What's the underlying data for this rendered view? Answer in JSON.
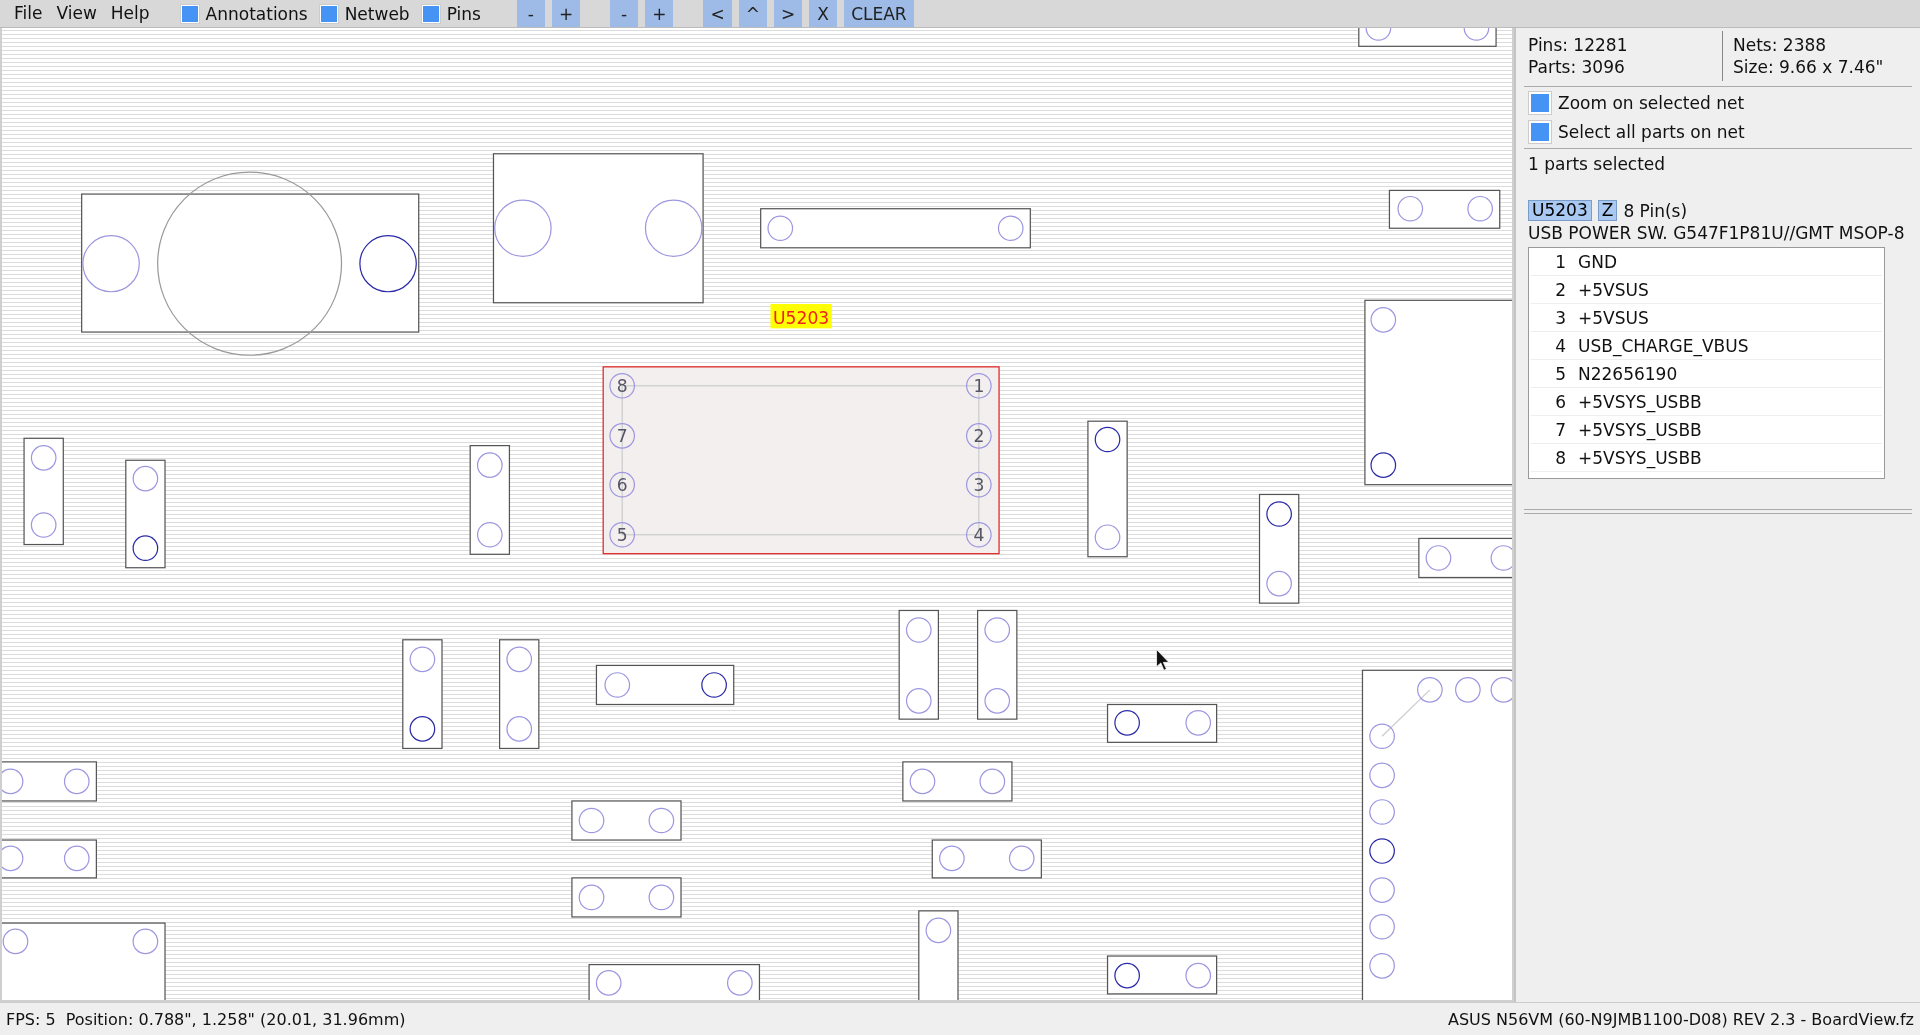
{
  "menu": [
    "File",
    "View",
    "Help"
  ],
  "toolbar": {
    "toggles": [
      {
        "label": "Annotations",
        "checked": true
      },
      {
        "label": "Netweb",
        "checked": true
      },
      {
        "label": "Pins",
        "checked": true
      }
    ],
    "button_groups": [
      [
        "-",
        "+"
      ],
      [
        "-",
        "+"
      ],
      [
        "<",
        "^",
        ">",
        "X",
        "CLEAR"
      ]
    ]
  },
  "canvas": {
    "selected_part": {
      "label": "U5203",
      "pins": [
        "8",
        "7",
        "6",
        "5",
        "1",
        "2",
        "3",
        "4"
      ]
    }
  },
  "panel": {
    "stats_left": [
      "Pins: 12281",
      "Parts: 3096"
    ],
    "stats_right": [
      "Nets: 2388",
      "Size: 9.66 x 7.46\""
    ],
    "options": [
      {
        "label": "Zoom on selected net",
        "checked": true
      },
      {
        "label": "Select all parts on net",
        "checked": true
      }
    ],
    "selection_count": "1 parts selected",
    "part": {
      "name": "U5203",
      "zoom_button": "Z",
      "pin_count": "8 Pin(s)",
      "description": "USB POWER SW. G547F1P81U//GMT MSOP-8",
      "pins": [
        {
          "number": "1",
          "net": "GND"
        },
        {
          "number": "2",
          "net": "+5VSUS"
        },
        {
          "number": "3",
          "net": "+5VSUS"
        },
        {
          "number": "4",
          "net": "USB_CHARGE_VBUS"
        },
        {
          "number": "5",
          "net": "N22656190"
        },
        {
          "number": "6",
          "net": "+5VSYS_USBB"
        },
        {
          "number": "7",
          "net": "+5VSYS_USBB"
        },
        {
          "number": "8",
          "net": "+5VSYS_USBB"
        }
      ]
    }
  },
  "status_bar": {
    "fps": "FPS: 5",
    "position": "Position: 0.788\", 1.258\" (20.01, 31.96mm)",
    "file": "ASUS N56VM (60-N9JMB1100-D08) REV 2.3 - BoardView.fz"
  }
}
